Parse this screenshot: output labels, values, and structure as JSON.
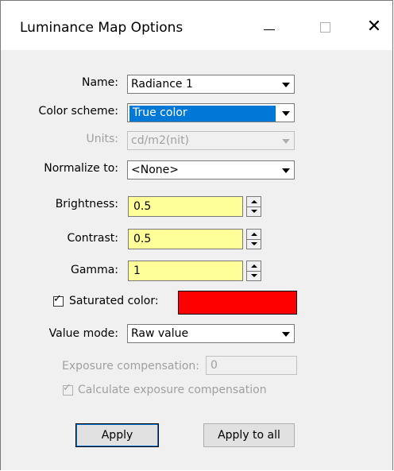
{
  "window": {
    "title": "Luminance Map Options",
    "minimize_glyph": "—",
    "maximize_glyph": "☐",
    "close_glyph": "✕"
  },
  "fields": {
    "name": {
      "label": "Name:",
      "value": "Radiance 1"
    },
    "color_scheme": {
      "label": "Color scheme:",
      "value": "True color"
    },
    "units": {
      "label": "Units:",
      "value": "cd/m2(nit)"
    },
    "normalize": {
      "label": "Normalize to:",
      "value": "<None>"
    },
    "brightness": {
      "label": "Brightness:",
      "value": "0.5"
    },
    "contrast": {
      "label": "Contrast:",
      "value": "0.5"
    },
    "gamma": {
      "label": "Gamma:",
      "value": "1"
    },
    "saturated_color": {
      "label": "Saturated color:",
      "checked": true,
      "color": "#ff0000"
    },
    "value_mode": {
      "label": "Value mode:",
      "value": "Raw value"
    },
    "exposure_compensation": {
      "label": "Exposure compensation:",
      "value": "0"
    },
    "calculate_exposure": {
      "label": "Calculate exposure compensation",
      "checked": true
    }
  },
  "buttons": {
    "apply": "Apply",
    "apply_all": "Apply to all"
  },
  "colors": {
    "input_highlight": "#ffff99",
    "selection": "#0078d7"
  }
}
